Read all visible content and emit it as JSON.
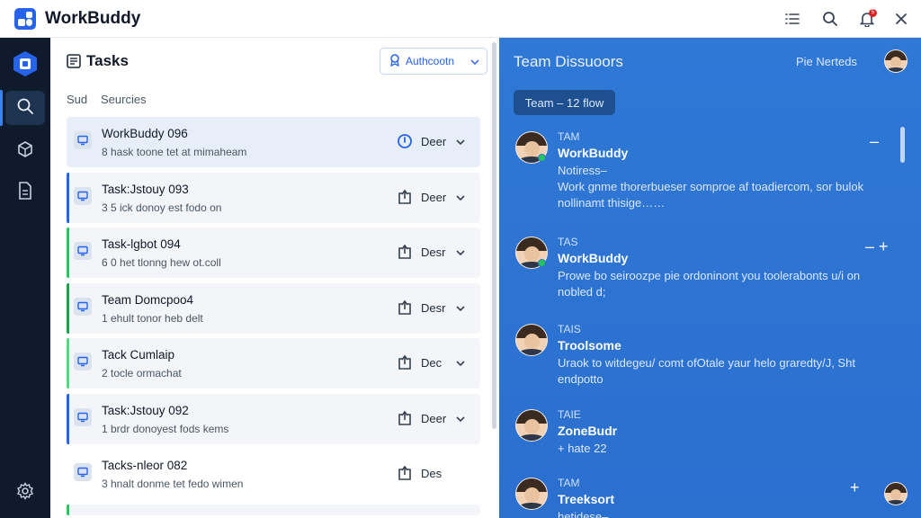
{
  "app": {
    "title": "WorkBuddy"
  },
  "titlebar": {
    "icons": [
      "list-icon",
      "search-icon",
      "bell-icon",
      "close-icon"
    ],
    "notification_count": "5"
  },
  "rail": {
    "items": [
      "search-icon",
      "cube-icon",
      "file-icon"
    ],
    "footer": "gear-icon"
  },
  "tasks": {
    "title": "Tasks",
    "auth_button": "Authcootn",
    "tabs": [
      "Sud",
      "Seurcies"
    ],
    "rows": [
      {
        "title": "WorkBuddy 096",
        "subtitle": "8 hask toone tet at mimaheam",
        "status": "Deer",
        "status_icon": "clock-icon",
        "accent": "",
        "chevron": true
      },
      {
        "title": "Task:Jstouy 093",
        "subtitle": "3 5 ick donoy est fodo on",
        "status": "Deer",
        "status_icon": "export-icon",
        "accent": "#2563eb",
        "chevron": true
      },
      {
        "title": "Task-lgbot 094",
        "subtitle": "6 0 het tlonng hew ot.coll",
        "status": "Desr",
        "status_icon": "export-icon",
        "accent": "#22c55e",
        "chevron": true
      },
      {
        "title": "Team Domcpoo4",
        "subtitle": "1 ehult tonor heb delt",
        "status": "Desr",
        "status_icon": "export-icon",
        "accent": "#16a34a",
        "chevron": true
      },
      {
        "title": "Tack Cumlaip",
        "subtitle": "2 tocle ormachat",
        "status": "Dec",
        "status_icon": "export-icon",
        "accent": "#4ade80",
        "chevron": true
      },
      {
        "title": "Task:Jstouy 092",
        "subtitle": "1 brdr donoyest fods kems",
        "status": "Deer",
        "status_icon": "export-icon",
        "accent": "#2563eb",
        "chevron": true
      },
      {
        "title": "Tacks-nleor 082",
        "subtitle": "3 hnalt donme tet fedo wimen",
        "status": "Des",
        "status_icon": "export-icon",
        "accent": "",
        "chevron": false
      }
    ]
  },
  "team": {
    "title": "Team Dissuoors",
    "user_label": "Pie Nerteds",
    "chip": "Team – 12 flow",
    "messages": [
      {
        "tag": "TAM",
        "name": "WorkBuddy",
        "text": [
          "Notiress–",
          "Work gnme thorerbueser somproe af toadiercom, sor bulok",
          "nollinamt thisige……"
        ],
        "online": true,
        "ctrl": "–"
      },
      {
        "tag": "TAS",
        "name": "WorkBuddy",
        "text": [
          "Prowe bo seiroozpe pie ordoninont you toolerabonts u/i on",
          "nobled d;"
        ],
        "online": true,
        "ctrl": "–  +"
      },
      {
        "tag": "TAIS",
        "name": "Troolsome",
        "text": [
          "Uraok to witdegeu/ comt ofOtale yaur helo graredty/J, Sht",
          "endpotto"
        ],
        "online": false,
        "ctrl": ""
      },
      {
        "tag": "TAIE",
        "name": "ZoneBudr",
        "text": [
          "+ hate 22"
        ],
        "online": false,
        "ctrl": ""
      },
      {
        "tag": "TAM",
        "name": "Treeksort",
        "text": [
          "hetidese–"
        ],
        "online": false,
        "ctrl": "+"
      }
    ]
  }
}
